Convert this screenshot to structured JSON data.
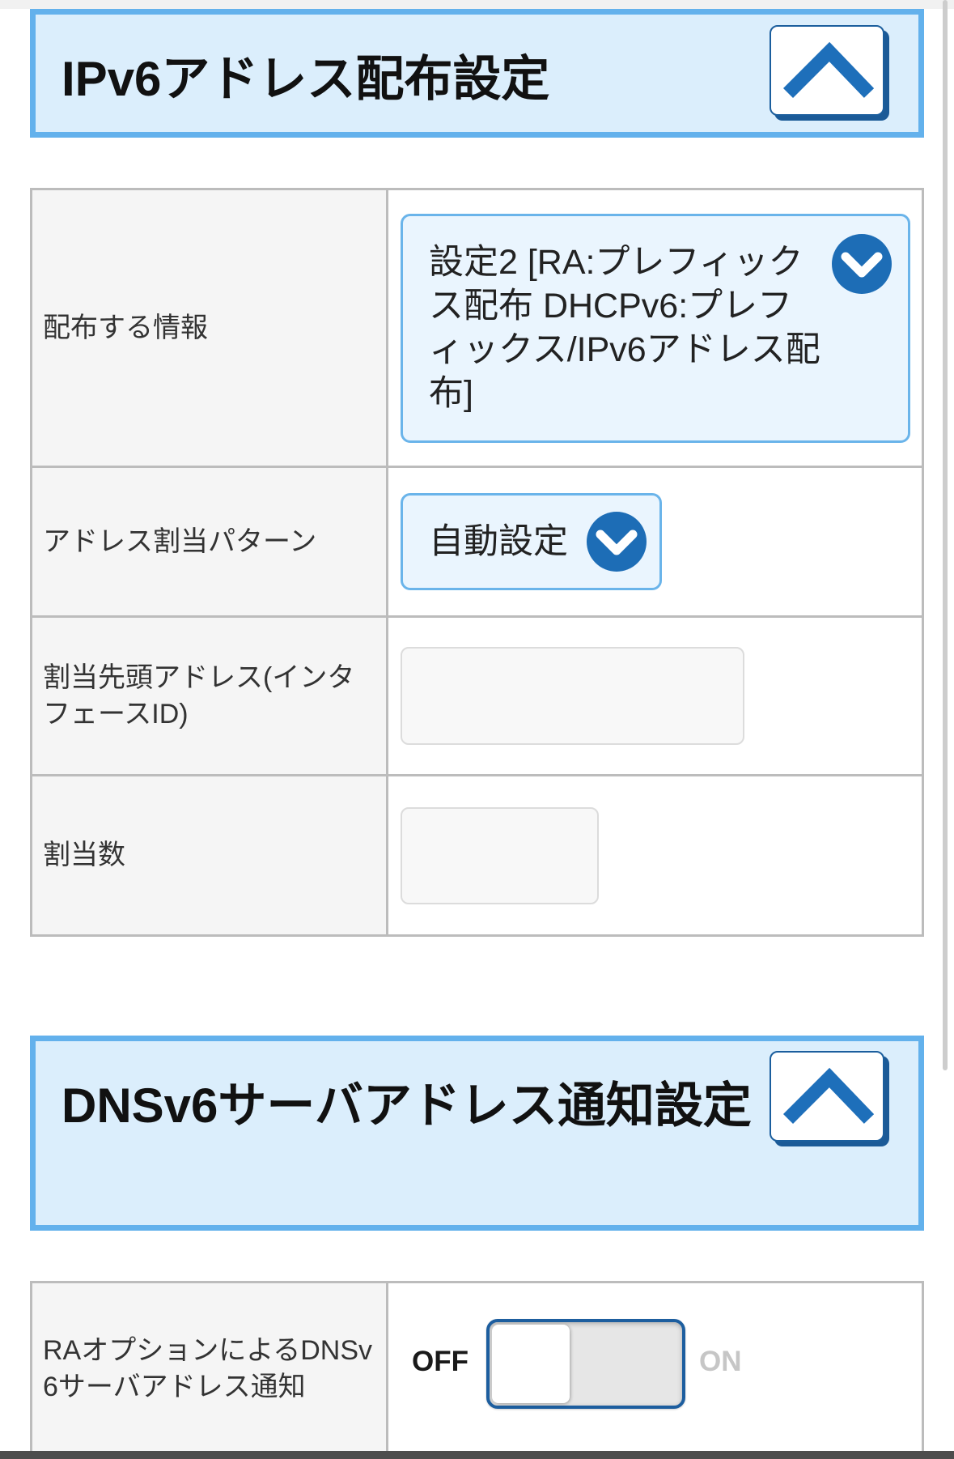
{
  "ipv6_distribution": {
    "title": "IPv6アドレス配布設定",
    "collapse_icon": "chevron-up-icon",
    "distribution_info": {
      "label": "配布する情報",
      "selected": "設定2 [RA:プレフィックス配布 DHCPv6:プレフィックス/IPv6アドレス配布]",
      "dropdown_icon": "chevron-down-icon"
    },
    "assignment_pattern": {
      "label": "アドレス割当パターン",
      "selected": "自動設定",
      "dropdown_icon": "chevron-down-icon"
    },
    "start_address": {
      "label": "割当先頭アドレス(インタフェースID)",
      "value": ""
    },
    "assignment_count": {
      "label": "割当数",
      "value": ""
    }
  },
  "dnsv6_notification": {
    "title": "DNSv6サーバアドレス通知設定",
    "collapse_icon": "chevron-up-icon",
    "ra_option": {
      "label": "RAオプションによるDNSv6サーバアドレス通知",
      "off_label": "OFF",
      "on_label": "ON",
      "enabled": false
    }
  },
  "colors": {
    "header_border": "#63b1ec",
    "header_background": "#dbeefc",
    "accent": "#1d6db6",
    "select_border": "#6ab4ea",
    "select_background": "#eaf5fe",
    "toggle_border": "#1d5e9f",
    "table_border": "#bcbcbc",
    "label_background": "#f5f5f5"
  }
}
